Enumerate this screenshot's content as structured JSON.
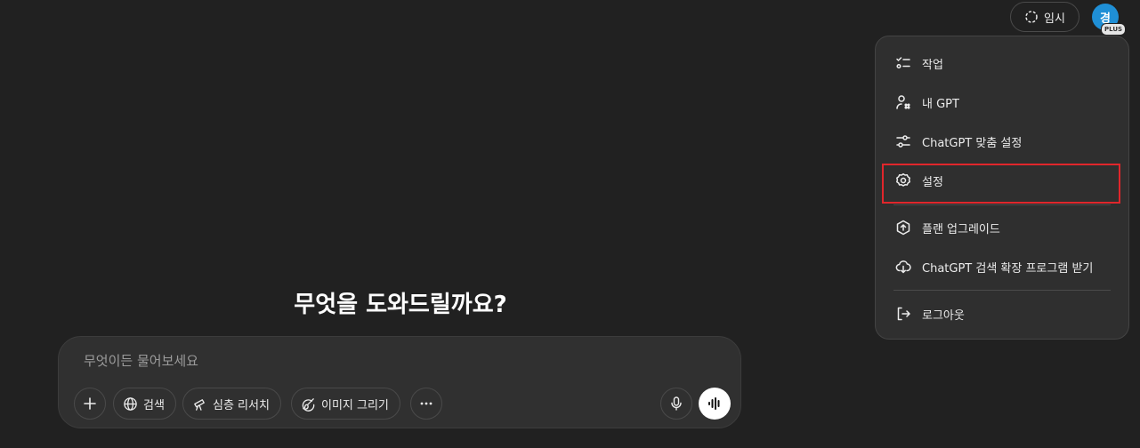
{
  "header": {
    "temporary_label": "임시",
    "avatar_initial": "경",
    "plan_badge": "PLUS"
  },
  "menu": {
    "items": [
      {
        "label": "작업",
        "icon": "tasks-icon"
      },
      {
        "label": "내 GPT",
        "icon": "my-gpt-icon"
      },
      {
        "label": "ChatGPT 맞춤 설정",
        "icon": "sliders-icon"
      },
      {
        "label": "설정",
        "icon": "gear-icon"
      },
      {
        "label": "플랜 업그레이드",
        "icon": "upgrade-icon"
      },
      {
        "label": "ChatGPT 검색 확장 프로그램 받기",
        "icon": "extension-icon"
      },
      {
        "label": "로그아웃",
        "icon": "logout-icon"
      }
    ],
    "highlighted_item": "설정",
    "highlight_color": "#e0262b"
  },
  "main": {
    "title": "무엇을 도와드릴까요?",
    "composer": {
      "placeholder": "무엇이든 물어보세요",
      "value": "",
      "tools": {
        "search_label": "검색",
        "research_label": "심층 리서치",
        "image_label": "이미지 그리기"
      }
    }
  },
  "colors": {
    "background": "#212121",
    "menu_background": "#2f2f2f",
    "composer_background": "#303030",
    "avatar": "#1f8fd6"
  }
}
